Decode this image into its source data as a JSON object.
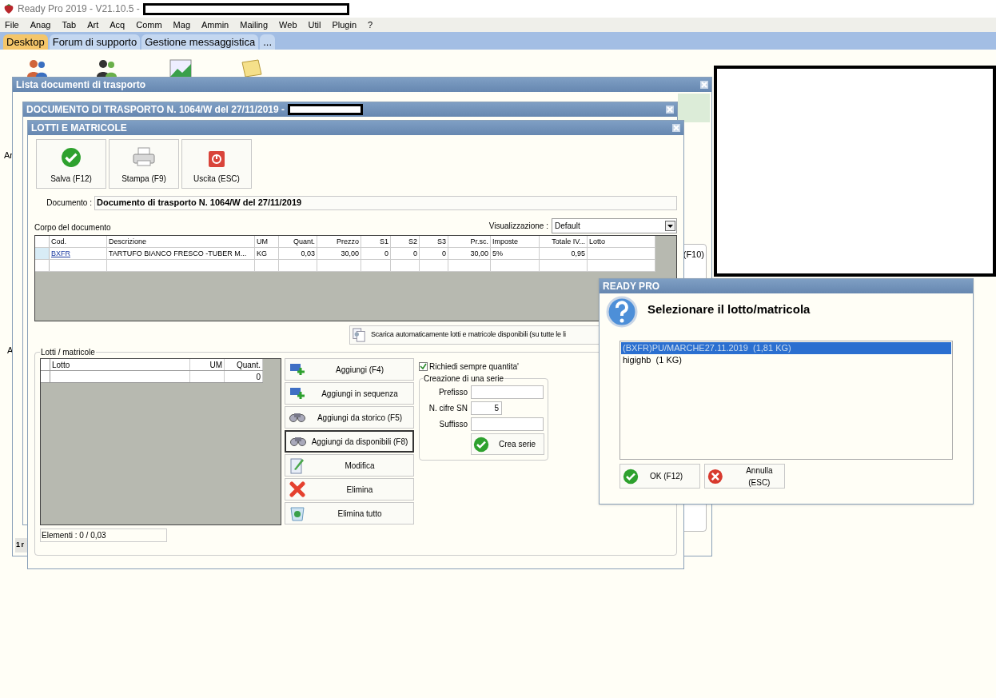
{
  "app": {
    "title": "Ready Pro 2019 - V21.10.5 -",
    "menu": [
      "File",
      "Anag",
      "Tab",
      "Art",
      "Acq",
      "Comm",
      "Mag",
      "Ammin",
      "Mailing",
      "Web",
      "Util",
      "Plugin",
      "?"
    ],
    "tabs": [
      {
        "label": "Desktop",
        "selected": true
      },
      {
        "label": "Forum di supporto",
        "selected": false
      },
      {
        "label": "Gestione messaggistica",
        "selected": false
      },
      {
        "label": "...",
        "selected": false
      }
    ],
    "desktop_labels": [
      "Ar",
      "A"
    ]
  },
  "list_window": {
    "title": "Lista documenti di trasporto",
    "fragment_right": "(F10)",
    "fragment_bottom": "1 r"
  },
  "document_window": {
    "title": "DOCUMENTO DI TRASPORTO N. 1064/W del 27/11/2019 -"
  },
  "lots_window": {
    "title": "LOTTI E MATRICOLE",
    "toolbar": [
      {
        "label": "Salva (F12)",
        "kind": "save"
      },
      {
        "label": "Stampa (F9)",
        "kind": "print"
      },
      {
        "label": "Uscita (ESC)",
        "kind": "exit"
      }
    ],
    "document_label": "Documento :",
    "document_value": "Documento di trasporto N. 1064/W del 27/11/2019",
    "body_label": "Corpo del documento",
    "view_label": "Visualizzazione :",
    "view_value": "Default",
    "table": {
      "columns": [
        "Cod.",
        "Descrizione",
        "UM",
        "Quant.",
        "Prezzo",
        "S1",
        "S2",
        "S3",
        "Pr.sc.",
        "Imposte",
        "Totale IV...",
        "Lotto"
      ],
      "rows": [
        [
          "BXFR",
          "TARTUFO BIANCO FRESCO -TUBER M...",
          "KG",
          "0,03",
          "30,00",
          "0",
          "0",
          "0",
          "30,00",
          "5%",
          "0,95",
          ""
        ]
      ]
    },
    "auto_button": "Scarica automaticamente lotti e matricole disponibili (su tutte le li",
    "lots_group": "Lotti / matricole",
    "lots_table": {
      "columns": [
        "Lotto",
        "UM",
        "Quant."
      ],
      "rows": [
        [
          "",
          "",
          "0"
        ]
      ]
    },
    "elements": "Elementi : 0 / 0,03",
    "actions": [
      {
        "label": "Aggiungi (F4)",
        "kind": "add",
        "focused": false
      },
      {
        "label": "Aggiungi in sequenza",
        "kind": "add",
        "focused": false
      },
      {
        "label": "Aggiungi da storico (F5)",
        "kind": "binoculars",
        "focused": false
      },
      {
        "label": "Aggiungi da disponibili (F8)",
        "kind": "binoculars",
        "focused": true
      },
      {
        "label": "Modifica",
        "kind": "edit",
        "focused": false
      },
      {
        "label": "Elimina",
        "kind": "delete",
        "focused": false
      },
      {
        "label": "Elimina tutto",
        "kind": "bin",
        "focused": false
      }
    ],
    "ask_quantity": {
      "label": "Richiedi sempre quantita'",
      "checked": true
    },
    "series": {
      "title": "Creazione di una serie",
      "fields": [
        {
          "label": "Prefisso",
          "kind": "wide"
        },
        {
          "label": "N. cifre SN",
          "value": "5",
          "kind": "narrow"
        },
        {
          "label": "Suffisso",
          "kind": "wide"
        }
      ],
      "button": "Crea serie"
    }
  },
  "dialog": {
    "title": "READY PRO",
    "message": "Selezionare il lotto/matricola",
    "options": [
      {
        "label": "(BXFR)PU/MARCHE27.11.2019  (1,81 KG)",
        "selected": true
      },
      {
        "label": "higighb  (1 KG)",
        "selected": false
      }
    ],
    "buttons": [
      {
        "label": "OK (F12)",
        "kind": "ok"
      },
      {
        "label": "Annulla (ESC)",
        "kind": "cancel"
      }
    ]
  }
}
